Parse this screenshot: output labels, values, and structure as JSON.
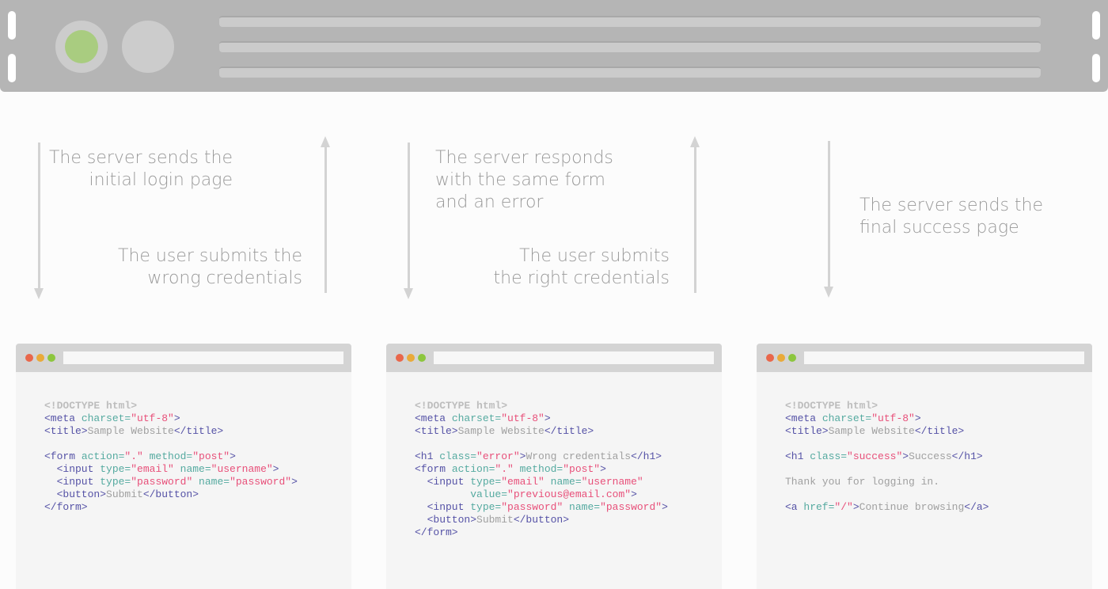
{
  "colors": {
    "server": "#b5b5b5",
    "led_green": "#a9cc80",
    "arrow": "#d3d3d3",
    "tag": "#5552a6",
    "attr": "#55aaa0",
    "string": "#e8507a",
    "text": "#a0a0a0",
    "dot_red": "#e9674b",
    "dot_yellow": "#e9aa3a",
    "dot_green": "#8cc63e"
  },
  "labels": [
    [
      "The server sends the",
      "initial login page"
    ],
    [
      "The user submits the",
      "wrong credentials"
    ],
    [
      "The server responds",
      "with the same form",
      "and an error"
    ],
    [
      "The user submits",
      "the right credentials"
    ],
    [
      "The server sends the",
      "final success page"
    ]
  ],
  "browsers": [
    {
      "lines": [
        [
          [
            "doc",
            "<!DOCTYPE html>"
          ]
        ],
        [
          [
            "tag",
            "<meta "
          ],
          [
            "attr",
            "charset="
          ],
          [
            "str",
            "\"utf-8\""
          ],
          [
            "tag",
            ">"
          ]
        ],
        [
          [
            "tag",
            "<title>"
          ],
          [
            "txt",
            "Sample Website"
          ],
          [
            "tag",
            "</title>"
          ]
        ],
        [],
        [
          [
            "tag",
            "<form "
          ],
          [
            "attr",
            "action="
          ],
          [
            "str",
            "\".\""
          ],
          [
            "attr",
            " method="
          ],
          [
            "str",
            "\"post\""
          ],
          [
            "tag",
            ">"
          ]
        ],
        [
          [
            "tag",
            "  <input "
          ],
          [
            "attr",
            "type="
          ],
          [
            "str",
            "\"email\""
          ],
          [
            "attr",
            " name="
          ],
          [
            "str",
            "\"username\""
          ],
          [
            "tag",
            ">"
          ]
        ],
        [
          [
            "tag",
            "  <input "
          ],
          [
            "attr",
            "type="
          ],
          [
            "str",
            "\"password\""
          ],
          [
            "attr",
            " name="
          ],
          [
            "str",
            "\"password\""
          ],
          [
            "tag",
            ">"
          ]
        ],
        [
          [
            "tag",
            "  <button>"
          ],
          [
            "txt",
            "Submit"
          ],
          [
            "tag",
            "</button>"
          ]
        ],
        [
          [
            "tag",
            "</form>"
          ]
        ]
      ]
    },
    {
      "lines": [
        [
          [
            "doc",
            "<!DOCTYPE html>"
          ]
        ],
        [
          [
            "tag",
            "<meta "
          ],
          [
            "attr",
            "charset="
          ],
          [
            "str",
            "\"utf-8\""
          ],
          [
            "tag",
            ">"
          ]
        ],
        [
          [
            "tag",
            "<title>"
          ],
          [
            "txt",
            "Sample Website"
          ],
          [
            "tag",
            "</title>"
          ]
        ],
        [],
        [
          [
            "tag",
            "<h1 "
          ],
          [
            "attr",
            "class="
          ],
          [
            "str",
            "\"error\""
          ],
          [
            "tag",
            ">"
          ],
          [
            "txt",
            "Wrong credentials"
          ],
          [
            "tag",
            "</h1>"
          ]
        ],
        [
          [
            "tag",
            "<form "
          ],
          [
            "attr",
            "action="
          ],
          [
            "str",
            "\".\""
          ],
          [
            "attr",
            " method="
          ],
          [
            "str",
            "\"post\""
          ],
          [
            "tag",
            ">"
          ]
        ],
        [
          [
            "tag",
            "  <input "
          ],
          [
            "attr",
            "type="
          ],
          [
            "str",
            "\"email\""
          ],
          [
            "attr",
            " name="
          ],
          [
            "str",
            "\"username\""
          ]
        ],
        [
          [
            "attr",
            "         value="
          ],
          [
            "str",
            "\"previous@email.com\""
          ],
          [
            "tag",
            ">"
          ]
        ],
        [
          [
            "tag",
            "  <input "
          ],
          [
            "attr",
            "type="
          ],
          [
            "str",
            "\"password\""
          ],
          [
            "attr",
            " name="
          ],
          [
            "str",
            "\"password\""
          ],
          [
            "tag",
            ">"
          ]
        ],
        [
          [
            "tag",
            "  <button>"
          ],
          [
            "txt",
            "Submit"
          ],
          [
            "tag",
            "</button>"
          ]
        ],
        [
          [
            "tag",
            "</form>"
          ]
        ]
      ]
    },
    {
      "lines": [
        [
          [
            "doc",
            "<!DOCTYPE html>"
          ]
        ],
        [
          [
            "tag",
            "<meta "
          ],
          [
            "attr",
            "charset="
          ],
          [
            "str",
            "\"utf-8\""
          ],
          [
            "tag",
            ">"
          ]
        ],
        [
          [
            "tag",
            "<title>"
          ],
          [
            "txt",
            "Sample Website"
          ],
          [
            "tag",
            "</title>"
          ]
        ],
        [],
        [
          [
            "tag",
            "<h1 "
          ],
          [
            "attr",
            "class="
          ],
          [
            "str",
            "\"success\""
          ],
          [
            "tag",
            ">"
          ],
          [
            "txt",
            "Success"
          ],
          [
            "tag",
            "</h1>"
          ]
        ],
        [],
        [
          [
            "txt",
            "Thank you for logging in."
          ]
        ],
        [],
        [
          [
            "tag",
            "<a "
          ],
          [
            "attr",
            "href="
          ],
          [
            "str",
            "\"/\""
          ],
          [
            "tag",
            ">"
          ],
          [
            "txt",
            "Continue browsing"
          ],
          [
            "tag",
            "</a>"
          ]
        ]
      ]
    }
  ]
}
